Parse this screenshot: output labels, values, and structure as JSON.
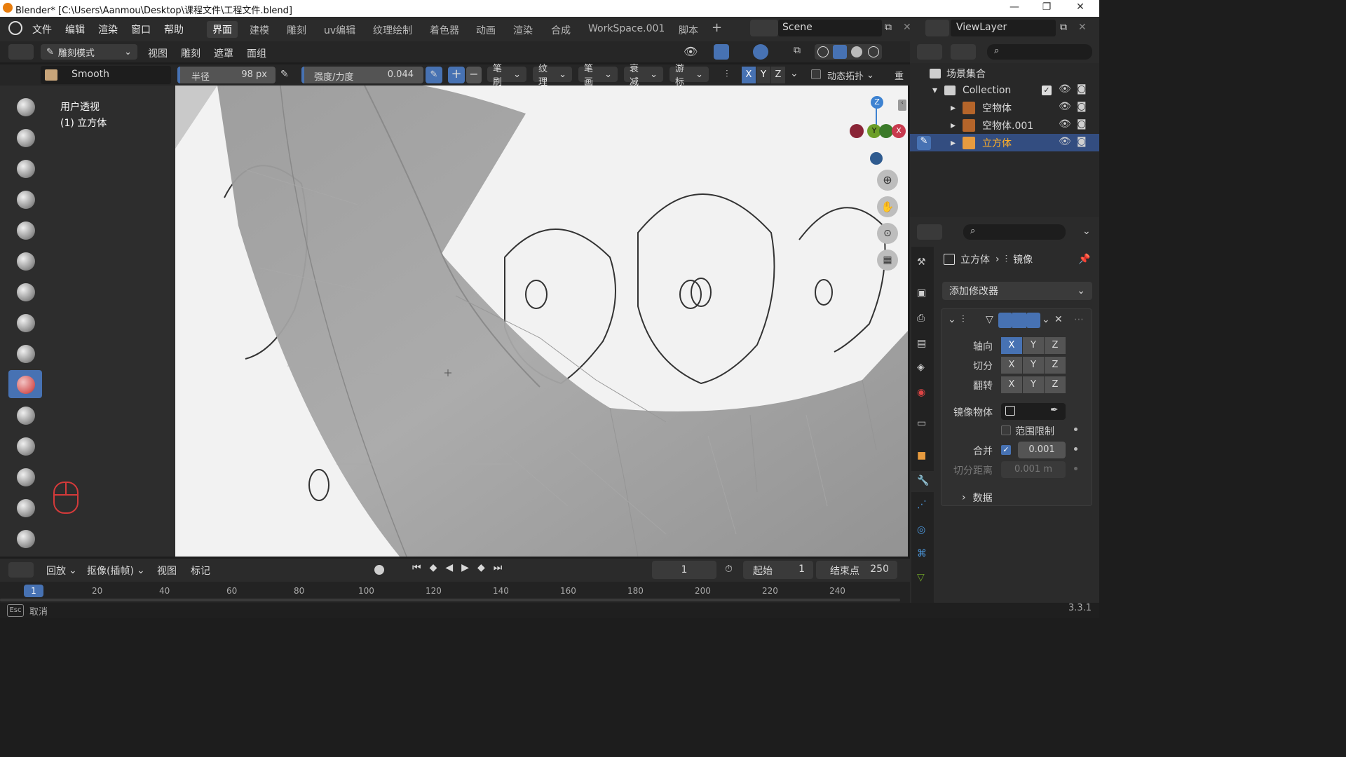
{
  "window": {
    "title": "Blender* [C:\\Users\\Aanmou\\Desktop\\课程文件\\工程文件.blend]"
  },
  "menu": [
    "文件",
    "编辑",
    "渲染",
    "窗口",
    "帮助"
  ],
  "workspaces": [
    "界面",
    "建模",
    "雕刻",
    "uv编辑",
    "纹理绘制",
    "着色器",
    "动画",
    "渲染",
    "合成",
    "WorkSpace.001",
    "脚本"
  ],
  "scene": {
    "label": "Scene"
  },
  "viewlayer": {
    "label": "ViewLayer"
  },
  "header2": {
    "mode": "雕刻模式",
    "items": [
      "视图",
      "雕刻",
      "遮罩",
      "面组"
    ]
  },
  "toolheader": {
    "brush_name": "Smooth",
    "radius_label": "半径",
    "radius_value": "98 px",
    "strength_label": "强度/力度",
    "strength_value": "0.044",
    "dropdowns": [
      "笔刷",
      "纹理",
      "笔画",
      "衰减",
      "游标"
    ],
    "axes": [
      "X",
      "Y",
      "Z"
    ],
    "dyntopo": "动态拓扑",
    "remesh": "重"
  },
  "viewport": {
    "info_line1": "用户透视",
    "info_line2": "(1) 立方体"
  },
  "gizmo": {
    "z": "Z",
    "y": "Y",
    "x": "X"
  },
  "outliner": {
    "root": "场景集合",
    "collection": "Collection",
    "items": [
      {
        "name": "空物体"
      },
      {
        "name": "空物体.001"
      },
      {
        "name": "立方体"
      }
    ]
  },
  "properties": {
    "breadcrumb_obj": "立方体",
    "breadcrumb_mod": "镜像",
    "add_modifier": "添加修改器",
    "axis_label": "轴向",
    "bisect_label": "切分",
    "flip_label": "翻转",
    "mirror_obj_label": "镜像物体",
    "clip_label": "范围限制",
    "merge_label": "合并",
    "merge_value": "0.001",
    "bisect_dist_label": "切分距离",
    "bisect_dist_value": "0.001 m",
    "data_label": "数据"
  },
  "timeline": {
    "menus": [
      "回放",
      "抠像(插帧)",
      "视图",
      "标记"
    ],
    "current_frame": "1",
    "start_label": "起始",
    "start_value": "1",
    "end_label": "结束点",
    "end_value": "250",
    "ruler": [
      "1",
      "20",
      "40",
      "60",
      "80",
      "100",
      "120",
      "140",
      "160",
      "180",
      "200",
      "220",
      "240"
    ]
  },
  "status": {
    "cancel": "取消",
    "version": "3.3.1"
  },
  "colors": {
    "accent": "#4772b3",
    "x_axis": "#c83a4e",
    "y_axis": "#6c9e28",
    "z_axis": "#3d82d1"
  }
}
